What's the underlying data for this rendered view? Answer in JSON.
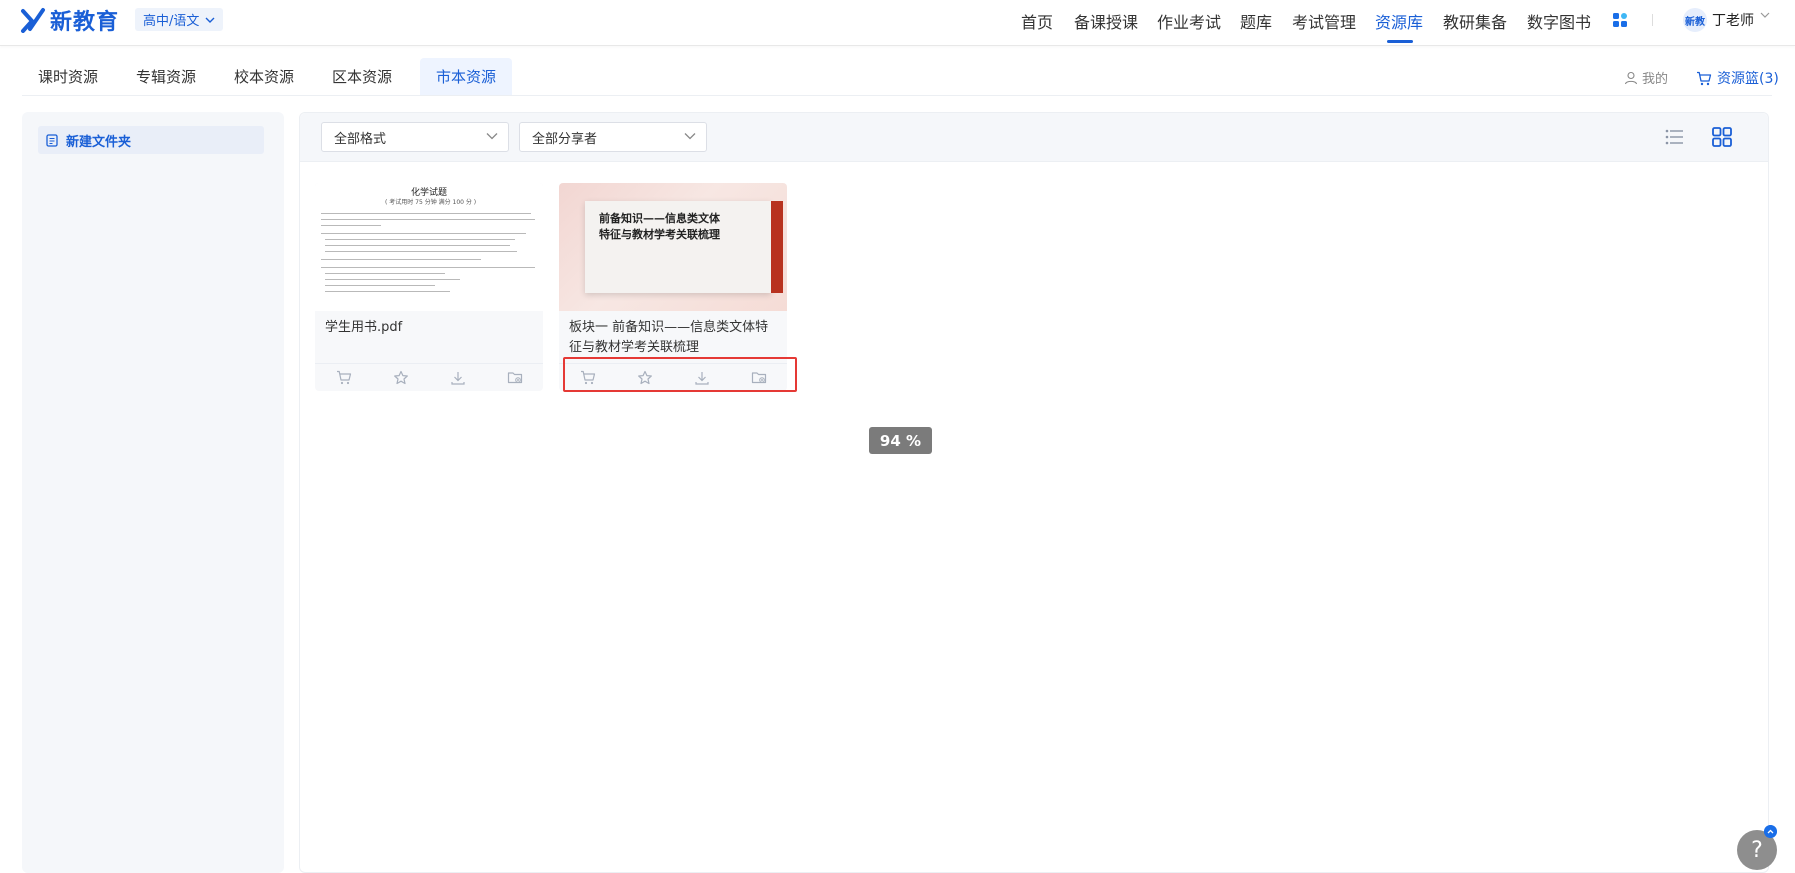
{
  "header": {
    "brand": "新教育",
    "grade_subject": "高中/语文",
    "nav": [
      "首页",
      "备课授课",
      "作业考试",
      "题库",
      "考试管理",
      "资源库",
      "教研集备",
      "数字图书"
    ],
    "active_nav": "资源库",
    "avatar_text": "新教",
    "user_name": "丁老师"
  },
  "tabs": {
    "items": [
      "课时资源",
      "专辑资源",
      "校本资源",
      "区本资源",
      "市本资源"
    ],
    "active": "市本资源",
    "my_label": "我的",
    "basket_label": "资源篮(3)"
  },
  "sidebar": {
    "new_folder_label": "新建文件夹"
  },
  "filters": {
    "format": "全部格式",
    "sharer": "全部分享者"
  },
  "cards": [
    {
      "title": "学生用书.pdf",
      "thumb_title": "化学试题",
      "thumb_subtitle": "( 考试用时 75 分钟    满分 100 分 )"
    },
    {
      "title": "板块一  前备知识——信息类文体特征与教材学考关联梳理",
      "thumb_text_line1": "前备知识——信息类文体",
      "thumb_text_line2": "特征与教材学考关联梳理"
    }
  ],
  "card_actions": [
    "cart-icon",
    "star-icon",
    "download-icon",
    "folder-add-icon"
  ],
  "zoom": "94 %",
  "help": "?",
  "colors": {
    "accent": "#1a5fd6",
    "highlight": "#e53935"
  }
}
